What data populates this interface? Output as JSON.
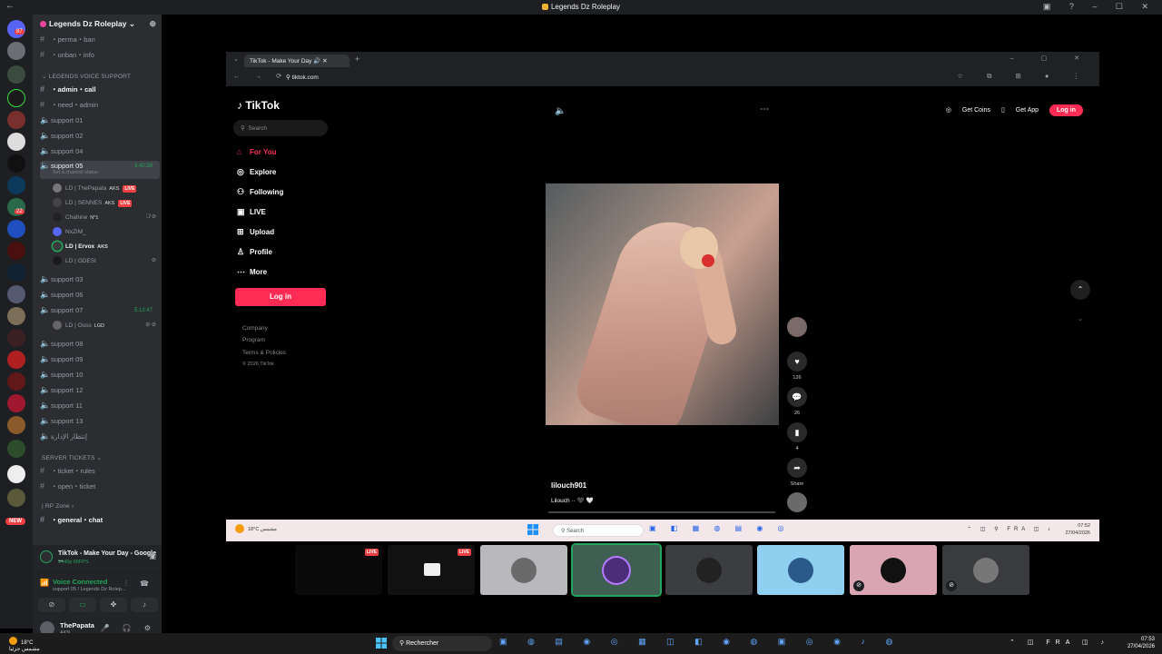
{
  "discord": {
    "title": "Legends Dz Roleplay",
    "guild_name": "Legends Dz Roleplay",
    "channels_top": [
      {
        "label": "・perma・ban"
      },
      {
        "label": "・unban・info"
      }
    ],
    "category_voice_support": "LEGENDS VOICE SUPPORT",
    "admin_call": "・admin・call",
    "need_admin": "・need・admin",
    "support_channels": [
      {
        "label": "support 01"
      },
      {
        "label": "support 02"
      },
      {
        "label": "support 04"
      }
    ],
    "support_05": {
      "label": "support 05",
      "timer": "3:40:39",
      "status": "Set a channel status"
    },
    "voice_users": [
      {
        "name": "LD | ThePapata",
        "tag": "AKS",
        "live": "LIVE"
      },
      {
        "name": "LD | SENNES",
        "tag": "AKS",
        "live": "LIVE"
      },
      {
        "name": "Chahine",
        "tag": "N°1"
      },
      {
        "name": "NxZIM_"
      },
      {
        "name": "LD | Ervox",
        "tag": "AKS"
      },
      {
        "name": "LD | ODESI"
      }
    ],
    "support_more": [
      {
        "label": "support 03"
      },
      {
        "label": "support 06"
      }
    ],
    "support_07": {
      "label": "support 07",
      "timer": "5:13:47"
    },
    "support_07_user": {
      "name": "LD | Ouss",
      "tag": "LGD"
    },
    "support_rest": [
      {
        "label": "support 08"
      },
      {
        "label": "support 09"
      },
      {
        "label": "support 10"
      },
      {
        "label": "support 12"
      },
      {
        "label": "support 11"
      },
      {
        "label": "support 13"
      },
      {
        "label": "إنتظار الإدارة"
      }
    ],
    "category_tickets": "SERVER TICKETS",
    "ticket_channels": [
      {
        "label": "・ticket・rules"
      },
      {
        "label": "・open・ticket"
      }
    ],
    "category_rp": "| RP Zone",
    "general_chat": "・general・chat",
    "new_badge": "NEW",
    "rail_badges": [
      "87",
      "22"
    ],
    "activity": {
      "title": "TikTok - Make Your Day - Google ...",
      "sub": "1440p 60FPS"
    },
    "voice_panel": {
      "status": "Voice Connected",
      "where": "support 05 / Legends Dz Rolep..."
    },
    "user": {
      "name": "ThePapata",
      "status": "AKN"
    }
  },
  "chrome": {
    "tab_title": "TikTok - Make Your Day",
    "url": "tiktok.com"
  },
  "tiktok": {
    "logo": "TikTok",
    "search_placeholder": "Search",
    "nav": [
      {
        "label": "For You",
        "icon": "home-icon"
      },
      {
        "label": "Explore",
        "icon": "compass-icon"
      },
      {
        "label": "Following",
        "icon": "following-icon"
      },
      {
        "label": "LIVE",
        "icon": "live-icon"
      },
      {
        "label": "Upload",
        "icon": "upload-icon"
      },
      {
        "label": "Profile",
        "icon": "profile-icon"
      },
      {
        "label": "More",
        "icon": "more-icon"
      }
    ],
    "login_side": "Log in",
    "footer": [
      "Company",
      "Program",
      "Terms & Policies"
    ],
    "copyright": "© 2026 TikTok",
    "get_coins": "Get Coins",
    "get_app": "Get App",
    "login_top": "Log in",
    "likes": "126",
    "comments": "26",
    "saves": "4",
    "share": "Share",
    "author": "lilouch901",
    "desc": "Lilouch ·· 🖤 🤍"
  },
  "inner_taskbar": {
    "weather_temp": "18°C",
    "weather_desc": "مشمس",
    "search": "Search",
    "lang": "FRA",
    "time": "07:52",
    "date": "27/04/2026"
  },
  "taskbar": {
    "weather_temp": "18°C",
    "weather_desc": "مشمس جزئيا",
    "search": "Rechercher",
    "lang": "FRA",
    "time": "07:53",
    "date": "27/04/2026"
  },
  "tiles": [
    {
      "live": "LIVE"
    },
    {
      "live": "LIVE"
    }
  ]
}
